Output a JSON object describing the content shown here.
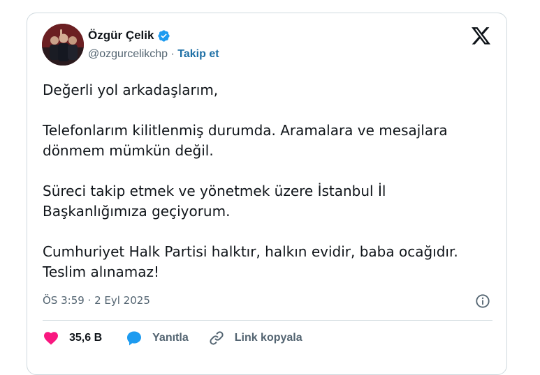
{
  "author": {
    "name": "Özgür Çelik",
    "handle": "@ozgurcelikchp",
    "separator": " · ",
    "follow_label": "Takip et"
  },
  "tweet": {
    "paragraphs": [
      "Değerli yol arkadaşlarım,",
      "Telefonlarım kilitlenmiş durumda. Aramalara ve mesajlara\ndönmem mümkün değil.",
      "Süreci takip etmek ve yönetmek üzere İstanbul İl\nBaşkanlığımıza geçiyorum.",
      "Cumhuriyet Halk Partisi halktır, halkın evidir, baba ocağıdır.\nTeslim alınamaz!"
    ],
    "timestamp": "ÖS 3:59 · 2 Eyl 2025"
  },
  "actions": {
    "likes": "35,6 B",
    "reply_label": "Yanıtla",
    "copy_link_label": "Link kopyala"
  },
  "colors": {
    "link": "#1d6fa5",
    "like": "#f91880",
    "reply": "#1d9bf0",
    "verified": "#1d9bf0"
  },
  "icons": {
    "verified": "verified-badge-icon",
    "platform": "x-logo-icon",
    "info": "info-icon",
    "like": "heart-icon",
    "reply": "speech-bubble-icon",
    "copy": "link-icon"
  }
}
